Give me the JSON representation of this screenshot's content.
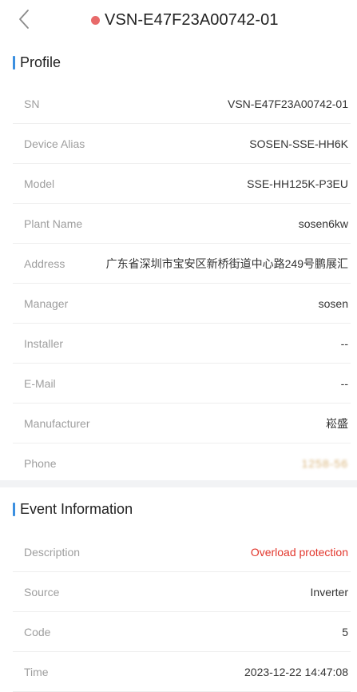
{
  "header": {
    "title": "VSN-E47F23A00742-01",
    "status_color": "#e86a6a",
    "back_icon": "chevron-left-icon"
  },
  "accent_color": "#3b8fe0",
  "profile": {
    "section_title": "Profile",
    "rows": [
      {
        "label": "SN",
        "value": "VSN-E47F23A00742-01"
      },
      {
        "label": "Device Alias",
        "value": "SOSEN-SSE-HH6K"
      },
      {
        "label": "Model",
        "value": "SSE-HH125K-P3EU"
      },
      {
        "label": "Plant Name",
        "value": "sosen6kw"
      },
      {
        "label": "Address",
        "value": "广东省深圳市宝安区新桥街道中心路249号鹏展汇"
      },
      {
        "label": "Manager",
        "value": "sosen"
      },
      {
        "label": "Installer",
        "value": "--"
      },
      {
        "label": "E-Mail",
        "value": "--"
      },
      {
        "label": "Manufacturer",
        "value": "崧盛"
      },
      {
        "label": "Phone",
        "value": "1258-56"
      }
    ]
  },
  "event": {
    "section_title": "Event Information",
    "alert_color": "#e2362c",
    "rows": [
      {
        "label": "Description",
        "value": "Overload protection"
      },
      {
        "label": "Source",
        "value": "Inverter"
      },
      {
        "label": "Code",
        "value": "5"
      },
      {
        "label": "Time",
        "value": "2023-12-22 14:47:08"
      }
    ]
  }
}
